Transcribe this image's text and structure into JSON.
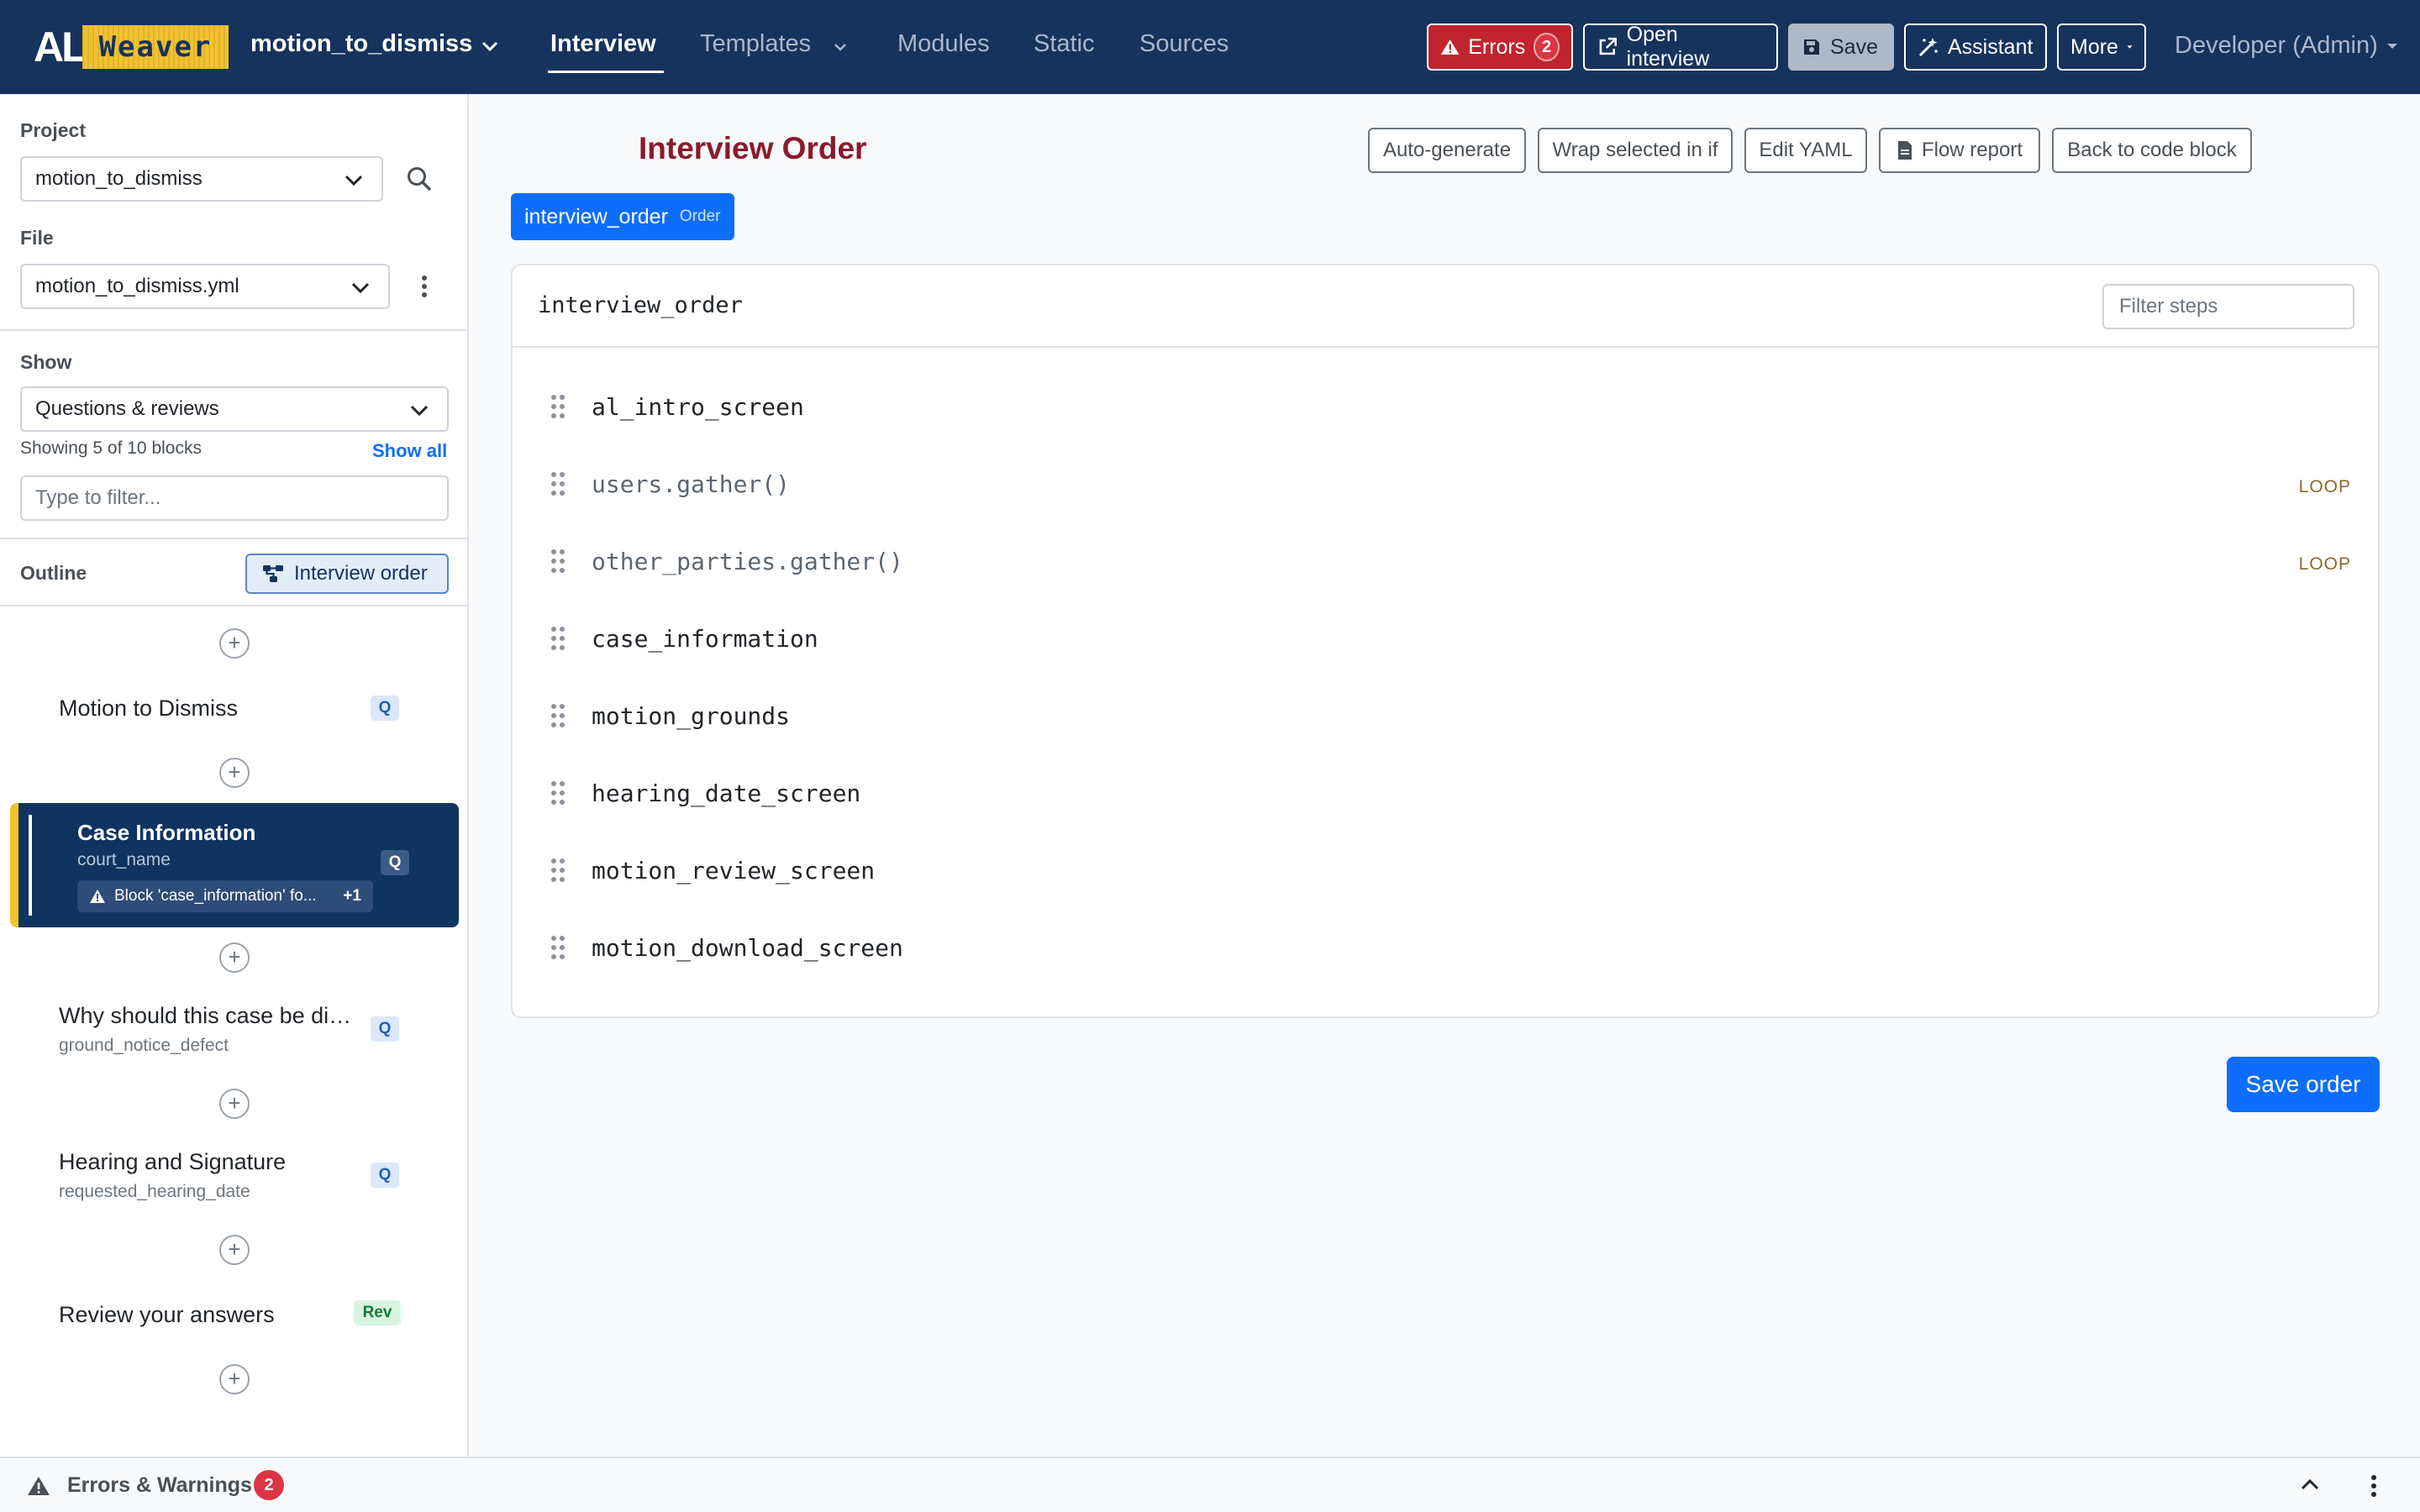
{
  "navbar": {
    "logo_al": "AL",
    "logo_weaver": "Weaver",
    "project_title": "motion_to_dismiss",
    "links": [
      {
        "label": "Interview"
      },
      {
        "label": "Templates"
      },
      {
        "label": "Modules"
      },
      {
        "label": "Static"
      },
      {
        "label": "Sources"
      }
    ],
    "errors_label": "Errors",
    "errors_count": "2",
    "open_interview_label": "Open interview",
    "save_label": "Save",
    "assistant_label": "Assistant",
    "more_label": "More",
    "user_label": "Developer (Admin)"
  },
  "sidebar": {
    "project_label": "Project",
    "project_value": "motion_to_dismiss",
    "file_label": "File",
    "file_value": "motion_to_dismiss.yml",
    "show_label": "Show",
    "show_value": "Questions & reviews",
    "showing_text": "Showing 5 of 10 blocks",
    "show_all": "Show all",
    "filter_placeholder": "Type to filter...",
    "outline_label": "Outline",
    "interview_order_button": "Interview order",
    "items": [
      {
        "title": "Motion to Dismiss",
        "var": "",
        "badge": "Q"
      },
      {
        "title": "Case Information",
        "var": "court_name",
        "badge": "Q",
        "warning": "Block 'case_information' fo...",
        "warning_more": "+1"
      },
      {
        "title": "Why should this case be dis...",
        "var": "ground_notice_defect",
        "badge": "Q"
      },
      {
        "title": "Hearing and Signature",
        "var": "requested_hearing_date",
        "badge": "Q"
      },
      {
        "title": "Review your answers",
        "var": "",
        "badge": "Rev"
      }
    ]
  },
  "main": {
    "title": "Interview Order",
    "toolbar": {
      "auto_generate": "Auto-generate",
      "wrap": "Wrap selected in if",
      "edit_yaml": "Edit YAML",
      "flow_report": "Flow report",
      "back": "Back to code block"
    },
    "tab": {
      "label": "interview_order",
      "tag": "Order"
    },
    "card_title": "interview_order",
    "filter_placeholder": "Filter steps",
    "steps": [
      {
        "name": "al_intro_screen",
        "tag": ""
      },
      {
        "name": "users.gather()",
        "tag": "LOOP"
      },
      {
        "name": "other_parties.gather()",
        "tag": "LOOP"
      },
      {
        "name": "case_information",
        "tag": ""
      },
      {
        "name": "motion_grounds",
        "tag": ""
      },
      {
        "name": "hearing_date_screen",
        "tag": ""
      },
      {
        "name": "motion_review_screen",
        "tag": ""
      },
      {
        "name": "motion_download_screen",
        "tag": ""
      }
    ],
    "save_order": "Save order"
  },
  "bottombar": {
    "label": "Errors & Warnings",
    "count": "2"
  },
  "colors": {
    "navbar": "#16335e",
    "accent": "#0d6efd",
    "error": "#dc3545",
    "title": "#8b1a2b",
    "selected": "#0f3460",
    "highlight": "#f2c230"
  },
  "icons": [
    "warning-icon",
    "external-link-icon",
    "save-icon",
    "magic-wand-icon",
    "search-icon",
    "kebab-icon",
    "chevron-down-icon",
    "flow-icon",
    "grip-icon",
    "plus-icon",
    "document-icon",
    "chevron-up-icon"
  ]
}
